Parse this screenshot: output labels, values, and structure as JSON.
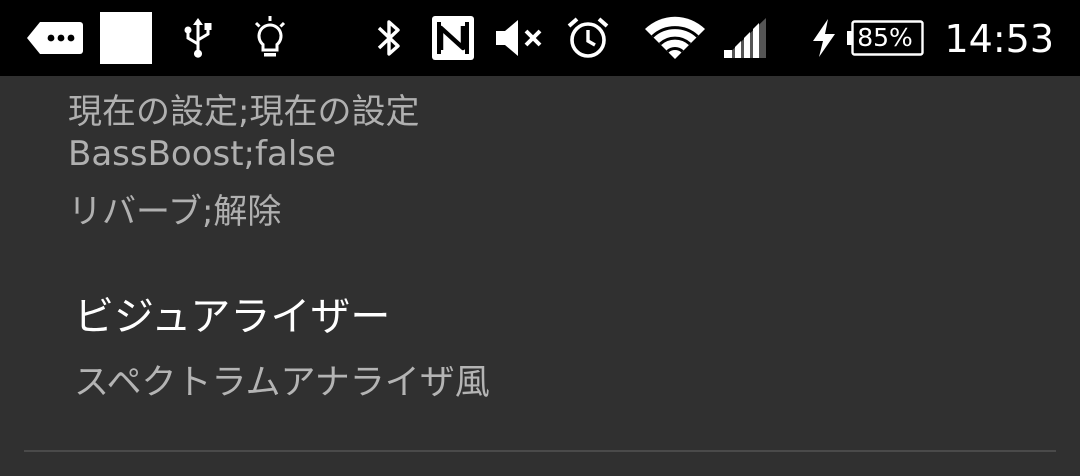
{
  "status_bar": {
    "time": "14:53",
    "battery_percent": "85%",
    "icons": [
      "notification-more-icon",
      "white-square-icon",
      "usb-icon",
      "lightbulb-icon",
      "bluetooth-icon",
      "nfc-icon",
      "volume-muted-icon",
      "alarm-icon",
      "wifi-icon",
      "cell-signal-icon",
      "charging-icon",
      "battery-icon"
    ]
  },
  "current_settings": {
    "lines": [
      "現在の設定;現在の設定",
      "BassBoost;false",
      "リバーブ;解除"
    ]
  },
  "visualizer": {
    "title": "ビジュアライザー",
    "summary": "スペクトラムアナライザ風"
  },
  "colors": {
    "background": "#303030",
    "status_bar": "#000000",
    "primary_text": "#ffffff",
    "secondary_text": "#b0b0b0"
  }
}
